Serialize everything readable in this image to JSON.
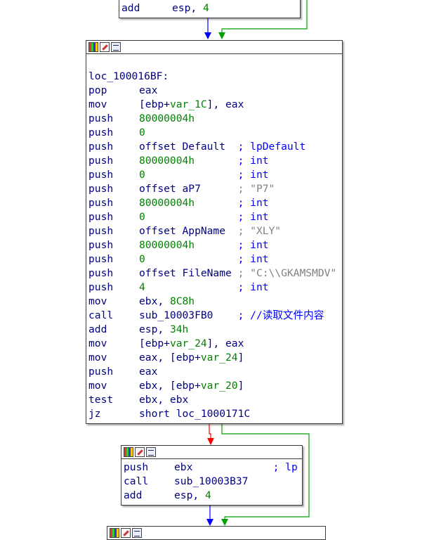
{
  "blocks": {
    "top": {
      "lines": [
        {
          "mn": "add",
          "ops": [
            {
              "t": "esp, ",
              "c": "plain"
            },
            {
              "t": "4",
              "c": "num"
            }
          ]
        }
      ]
    },
    "main": {
      "label": "loc_100016BF:",
      "lines": [
        {
          "mn": "pop",
          "ops": [
            {
              "t": "eax",
              "c": "plain"
            }
          ]
        },
        {
          "mn": "mov",
          "ops": [
            {
              "t": "[ebp+",
              "c": "plain"
            },
            {
              "t": "var_1C",
              "c": "var"
            },
            {
              "t": "], eax",
              "c": "plain"
            }
          ]
        },
        {
          "mn": "push",
          "ops": [
            {
              "t": "80000004h",
              "c": "num"
            }
          ]
        },
        {
          "mn": "push",
          "ops": [
            {
              "t": "0",
              "c": "num"
            }
          ]
        },
        {
          "mn": "push",
          "ops": [
            {
              "t": "offset Default  ",
              "c": "plain"
            },
            {
              "t": "; lpDefault",
              "c": "cmt"
            }
          ]
        },
        {
          "mn": "push",
          "ops": [
            {
              "t": "80000004h",
              "c": "num"
            },
            {
              "t": "       ",
              "c": "plain"
            },
            {
              "t": "; int",
              "c": "cmt"
            }
          ]
        },
        {
          "mn": "push",
          "ops": [
            {
              "t": "0",
              "c": "num"
            },
            {
              "t": "               ",
              "c": "plain"
            },
            {
              "t": "; int",
              "c": "cmt"
            }
          ]
        },
        {
          "mn": "push",
          "ops": [
            {
              "t": "offset aP7      ",
              "c": "plain"
            },
            {
              "t": "; \"P7\"",
              "c": "gcmt"
            }
          ]
        },
        {
          "mn": "push",
          "ops": [
            {
              "t": "80000004h",
              "c": "num"
            },
            {
              "t": "       ",
              "c": "plain"
            },
            {
              "t": "; int",
              "c": "cmt"
            }
          ]
        },
        {
          "mn": "push",
          "ops": [
            {
              "t": "0",
              "c": "num"
            },
            {
              "t": "               ",
              "c": "plain"
            },
            {
              "t": "; int",
              "c": "cmt"
            }
          ]
        },
        {
          "mn": "push",
          "ops": [
            {
              "t": "offset AppName  ",
              "c": "plain"
            },
            {
              "t": "; \"XLY\"",
              "c": "gcmt"
            }
          ]
        },
        {
          "mn": "push",
          "ops": [
            {
              "t": "80000004h",
              "c": "num"
            },
            {
              "t": "       ",
              "c": "plain"
            },
            {
              "t": "; int",
              "c": "cmt"
            }
          ]
        },
        {
          "mn": "push",
          "ops": [
            {
              "t": "0",
              "c": "num"
            },
            {
              "t": "               ",
              "c": "plain"
            },
            {
              "t": "; int",
              "c": "cmt"
            }
          ]
        },
        {
          "mn": "push",
          "ops": [
            {
              "t": "offset FileName ",
              "c": "plain"
            },
            {
              "t": "; \"C:\\\\GKAMSMDV\"",
              "c": "gcmt"
            }
          ]
        },
        {
          "mn": "push",
          "ops": [
            {
              "t": "4",
              "c": "num"
            },
            {
              "t": "               ",
              "c": "plain"
            },
            {
              "t": "; int",
              "c": "cmt"
            }
          ]
        },
        {
          "mn": "mov",
          "ops": [
            {
              "t": "ebx, ",
              "c": "plain"
            },
            {
              "t": "8C8h",
              "c": "num"
            }
          ]
        },
        {
          "mn": "call",
          "ops": [
            {
              "t": "sub_10003FB0    ",
              "c": "plain"
            },
            {
              "t": "; //读取文件内容",
              "c": "cmt"
            }
          ]
        },
        {
          "mn": "add",
          "ops": [
            {
              "t": "esp, ",
              "c": "plain"
            },
            {
              "t": "34h",
              "c": "num"
            }
          ]
        },
        {
          "mn": "mov",
          "ops": [
            {
              "t": "[ebp+",
              "c": "plain"
            },
            {
              "t": "var_24",
              "c": "var"
            },
            {
              "t": "], eax",
              "c": "plain"
            }
          ]
        },
        {
          "mn": "mov",
          "ops": [
            {
              "t": "eax, [ebp+",
              "c": "plain"
            },
            {
              "t": "var_24",
              "c": "var"
            },
            {
              "t": "]",
              "c": "plain"
            }
          ]
        },
        {
          "mn": "push",
          "ops": [
            {
              "t": "eax",
              "c": "plain"
            }
          ]
        },
        {
          "mn": "mov",
          "ops": [
            {
              "t": "ebx, [ebp+",
              "c": "plain"
            },
            {
              "t": "var_20",
              "c": "var"
            },
            {
              "t": "]",
              "c": "plain"
            }
          ]
        },
        {
          "mn": "test",
          "ops": [
            {
              "t": "ebx, ebx",
              "c": "plain"
            }
          ]
        },
        {
          "mn": "jz",
          "ops": [
            {
              "t": "short loc_1000171C",
              "c": "plain"
            }
          ]
        }
      ]
    },
    "lower": {
      "lines": [
        {
          "mn": "push",
          "ops": [
            {
              "t": "ebx             ",
              "c": "plain"
            },
            {
              "t": "; lp",
              "c": "cmt"
            }
          ]
        },
        {
          "mn": "call",
          "ops": [
            {
              "t": "sub_10003B37",
              "c": "plain"
            }
          ]
        },
        {
          "mn": "add",
          "ops": [
            {
              "t": "esp, ",
              "c": "plain"
            },
            {
              "t": "4",
              "c": "num"
            }
          ]
        }
      ]
    }
  },
  "colors": {
    "text": "#000080",
    "number": "#008000",
    "comment": "#0000ff",
    "string_comment": "#808080",
    "edge_true": "#0000ff",
    "edge_false": "#00a000",
    "edge_jump_taken": "#ff0000"
  }
}
